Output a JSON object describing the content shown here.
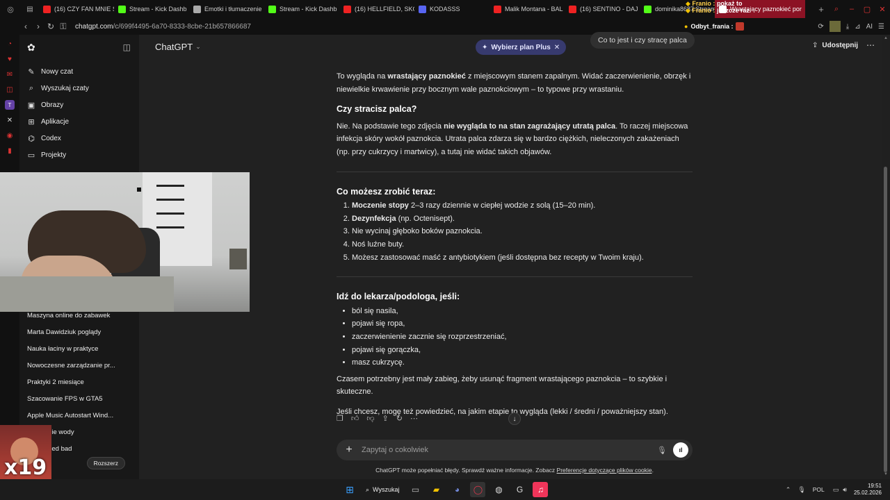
{
  "browser": {
    "tabs": [
      {
        "label": "(16) CZY FAN MNIE S",
        "color": "#e22"
      },
      {
        "label": "Stream - Kick Dashb",
        "color": "#53fc18"
      },
      {
        "label": "Emotki i tłumaczenie",
        "color": "#aaa"
      },
      {
        "label": "Stream - Kick Dashb",
        "color": "#53fc18"
      },
      {
        "label": "(16) HELLFIELD, SKO",
        "color": "#e22"
      },
      {
        "label": "KODASSS",
        "color": "#5865f2"
      },
      {
        "label": "Malik Montana - BAL",
        "color": "#e22"
      },
      {
        "label": "(16) SENTINO - DAJ",
        "color": "#e22"
      },
      {
        "label": "dominika8687 Stream",
        "color": "#53fc18"
      },
      {
        "label": "Wrastający paznokieć por",
        "color": "#fff"
      }
    ],
    "url_prefix": "chatgpt.com",
    "url_rest": "/c/699f4495-6a70-8333-8cbe-21b657866687",
    "ai_label": "AI"
  },
  "stream_overlay": {
    "chat_lines": [
      {
        "user": "Franio :",
        "msg": "pokaż to"
      },
      {
        "user": "Franio :",
        "msg": "jeszcze raz"
      }
    ],
    "event_user": "Odbyt_frania :",
    "counter": "x19"
  },
  "sidebar": {
    "items": [
      {
        "label": "Nowy czat",
        "icon": "edit-icon"
      },
      {
        "label": "Wyszukaj czaty",
        "icon": "search-icon"
      },
      {
        "label": "Obrazy",
        "icon": "image-icon"
      },
      {
        "label": "Aplikacje",
        "icon": "apps-icon"
      },
      {
        "label": "Codex",
        "icon": "codex-icon"
      },
      {
        "label": "Projekty",
        "icon": "folder-icon"
      }
    ],
    "chats": [
      "Maszyna online do zabawek",
      "Marta Dawidziuk poglądy",
      "Nauka łaciny w praktyce",
      "Nowoczesne zarządzanie pr...",
      "Praktyki 2 miesiące",
      "Szacowanie FPS w GTA5",
      "Apple Music Autostart Wind...",
      "gia a picie wody",
      "Zero przed bad",
      "ciej g"
    ],
    "upgrade_button": "Rozszerz",
    "user_sub": "ee"
  },
  "header": {
    "model": "ChatGPT",
    "plan_pill": "Wybierz plan Plus",
    "user_bubble": "Co to jest i czy stracę palca",
    "share": "Udostępnij"
  },
  "message": {
    "p1_a": "To wygląda na ",
    "p1_b": "wrastający paznokieć",
    "p1_c": " z miejscowym stanem zapalnym. Widać zaczerwienienie, obrzęk i niewielkie krwawienie przy bocznym wale paznokciowym – to typowe przy wrastaniu.",
    "h1": "Czy stracisz palca?",
    "p2_a": "Nie. Na podstawie tego zdjęcia ",
    "p2_b": "nie wygląda to na stan zagrażający utratą palca",
    "p2_c": ". To raczej miejscowa infekcja skóry wokół paznokcia. Utrata palca zdarza się w bardzo ciężkich, nieleczonych zakażeniach (np. przy cukrzycy i martwicy), a tutaj nie widać takich objawów.",
    "h2": "Co możesz zrobić teraz:",
    "steps": [
      {
        "bold": "Moczenie stopy",
        "rest": " 2–3 razy dziennie w ciepłej wodzie z solą (15–20 min)."
      },
      {
        "bold": "Dezynfekcja",
        "rest": " (np. Octenisept)."
      },
      {
        "bold": "",
        "rest": "Nie wycinaj głęboko boków paznokcia."
      },
      {
        "bold": "",
        "rest": "Noś luźne buty."
      },
      {
        "bold": "",
        "rest": "Możesz zastosować maść z antybiotykiem (jeśli dostępna bez recepty w Twoim kraju)."
      }
    ],
    "h3": "Idź do lekarza/podologa, jeśli:",
    "bullets": [
      "ból się nasila,",
      "pojawi się ropa,",
      "zaczerwienienie zacznie się rozprzestrzeniać,",
      "pojawi się gorączka,",
      "masz cukrzycę."
    ],
    "p3": "Czasem potrzebny jest mały zabieg, żeby usunąć fragment wrastającego paznokcia – to szybkie i skuteczne.",
    "p4": "Jeśli chcesz, mogę też powiedzieć, na jakim etapie to wygląda (lekki / średni / poważniejszy stan)."
  },
  "composer": {
    "placeholder": "Zapytaj o cokolwiek"
  },
  "footer": {
    "text": "ChatGPT może popełniać błędy. Sprawdź ważne informacje. Zobacz ",
    "link": "Preferencje dotyczące plików cookie",
    "end": "."
  },
  "taskbar": {
    "search": "Wyszukaj",
    "lang": "POL",
    "time": "19:51",
    "date": "25.02.2026"
  }
}
